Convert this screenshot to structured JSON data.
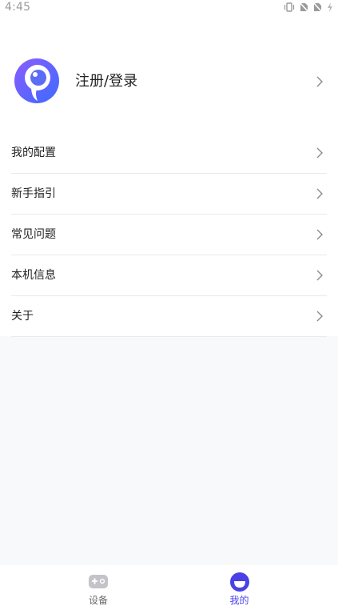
{
  "status_bar": {
    "time": "4:45",
    "icons": [
      "vibrate-icon",
      "no-sim-icon",
      "no-sim-icon",
      "charging-icon"
    ]
  },
  "profile": {
    "label": "注册/登录",
    "avatar_icon": "app-logo-icon"
  },
  "menu": {
    "items": [
      {
        "label": "我的配置"
      },
      {
        "label": "新手指引"
      },
      {
        "label": "常见问题"
      },
      {
        "label": "本机信息"
      },
      {
        "label": "关于"
      }
    ]
  },
  "bottom_nav": {
    "tabs": [
      {
        "label": "设备",
        "icon": "gamepad-icon",
        "active": false
      },
      {
        "label": "我的",
        "icon": "smile-icon",
        "active": true
      }
    ]
  },
  "colors": {
    "accent": "#4b3fe6",
    "inactive": "#6b6b6b",
    "divider": "#e9e9ec",
    "background": "#f8f9fb"
  }
}
